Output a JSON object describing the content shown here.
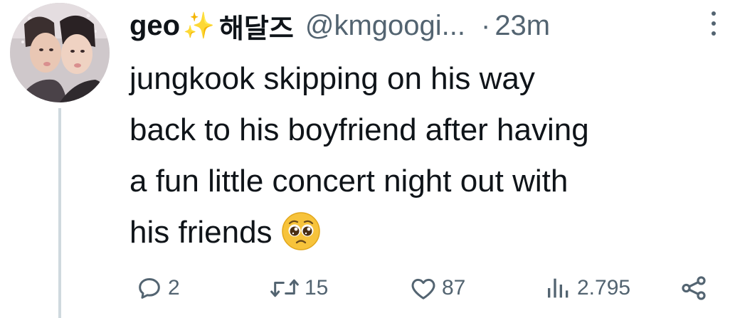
{
  "tweet": {
    "author": {
      "display_name": "geo",
      "emoji": "✨",
      "name_kr": "해달즈",
      "handle": "@kmgoogi...",
      "separator": "·",
      "timestamp": "23m"
    },
    "text_lines": [
      "jungkook skipping on his way",
      "back to his boyfriend after having",
      "a fun little concert night out with",
      "his friends"
    ],
    "trailing_emoji": "pleading-face-emoji"
  },
  "actions": {
    "reply_count": "2",
    "retweet_count": "15",
    "like_count": "87",
    "views_count": "2.795"
  },
  "icons": {
    "reply": "reply-icon",
    "retweet": "retweet-icon",
    "like": "heart-icon",
    "views": "views-icon",
    "share": "share-icon",
    "more": "more-icon"
  },
  "colors": {
    "text": "#0f1419",
    "muted": "#536471",
    "thread_line": "#cfd9de",
    "emoji_yellow": "#f7c33b"
  }
}
